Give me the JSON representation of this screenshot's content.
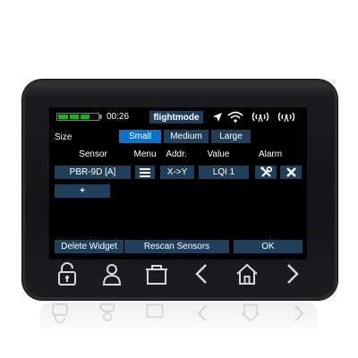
{
  "statusbar": {
    "battery_level": 0.8,
    "time": "00:26",
    "mode": "flightmode",
    "icons": [
      "gps-arrow-icon",
      "wifi-icon",
      "telemetry-signal-icon",
      "rf-signal-icon"
    ]
  },
  "size": {
    "label": "Size",
    "options": [
      "Small",
      "Medium",
      "Large"
    ],
    "selected": "Small"
  },
  "table": {
    "headers": [
      "Sensor",
      "Menu",
      "Addr.",
      "Value",
      "Alarm"
    ],
    "row": {
      "sensor": "PBR-9D [A]",
      "menu_icon": "hamburger-menu-icon",
      "addr": "X->Y",
      "value": "LQI 1",
      "alarm_icons": [
        "tools-icon",
        "close-icon"
      ]
    },
    "add_label": "+"
  },
  "footer": {
    "delete_label": "Delete Widget",
    "rescan_label": "Rescan Sensors",
    "ok_label": "OK"
  },
  "hardware_buttons": [
    "unlock-icon",
    "user-icon",
    "model-icon",
    "chevron-left-icon",
    "home-icon",
    "chevron-right-icon"
  ],
  "colors": {
    "button": "#1f3f5a",
    "selected": "#0a72c8",
    "battery": "#19b419",
    "screen": "#000000"
  }
}
